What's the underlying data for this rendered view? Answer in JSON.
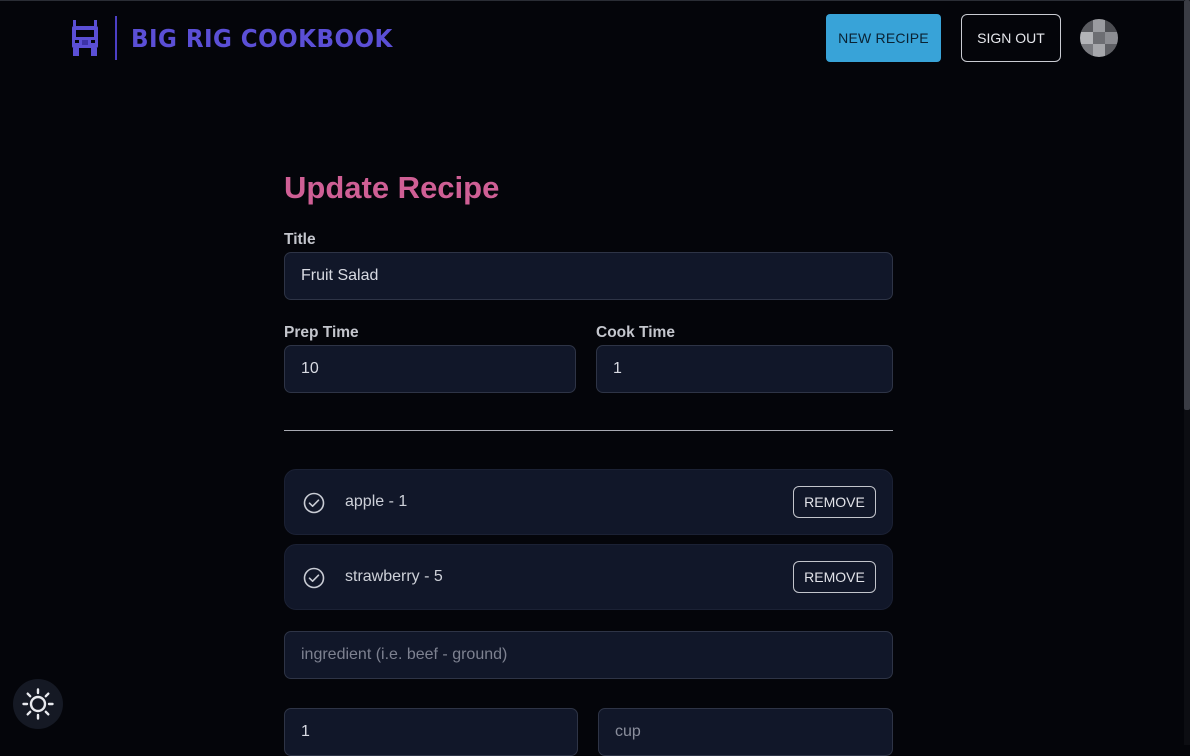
{
  "header": {
    "brand_name": "BIG RIG COOKBOOK",
    "brand_icon": "truck-icon",
    "new_recipe_label": "NEW RECIPE",
    "sign_out_label": "SIGN OUT",
    "avatar_icon": "user-avatar"
  },
  "form": {
    "heading": "Update Recipe",
    "title_label": "Title",
    "title_value": "Fruit Salad",
    "prep_time_label": "Prep Time",
    "prep_time_value": "10",
    "cook_time_label": "Cook Time",
    "cook_time_value": "1",
    "ingredients": [
      {
        "text": "apple - 1",
        "remove_label": "REMOVE",
        "icon": "check-circle-icon"
      },
      {
        "text": "strawberry - 5",
        "remove_label": "REMOVE",
        "icon": "check-circle-icon"
      }
    ],
    "ingredient_placeholder": "ingredient (i.e. beef - ground)",
    "quantity_value": "1",
    "unit_value": "cup"
  },
  "theme_toggle_icon": "sun-icon",
  "colors": {
    "background": "#04050a",
    "brand": "#5b4fd6",
    "heading": "#cf5f95",
    "primary_button": "#38a3d8",
    "field_background": "#111729"
  }
}
